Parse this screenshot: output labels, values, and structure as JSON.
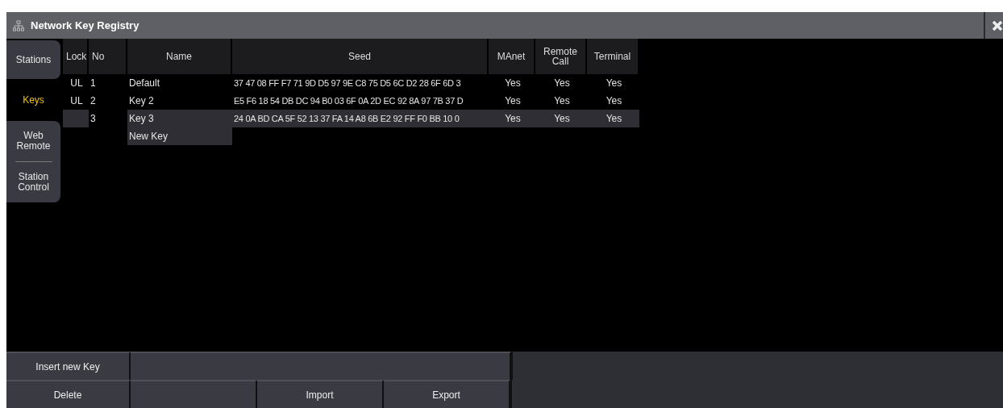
{
  "window": {
    "title": "Network Key Registry"
  },
  "tabs": [
    {
      "label": "Stations",
      "selected": false
    },
    {
      "label": "Keys",
      "selected": true
    },
    {
      "label": "Web Remote",
      "selected": false
    },
    {
      "label": "Station Control",
      "selected": false
    }
  ],
  "table": {
    "columns": [
      "Lock",
      "No",
      "Name",
      "Seed",
      "MAnet",
      "Remote Call",
      "Terminal"
    ],
    "rows": [
      {
        "lock": "UL",
        "no": "1",
        "name": "Default",
        "seed": "37 47 08 FF F7 71 9D D5 97 9E C8 75 D5 6C D2 28 6F 6D 3",
        "manet": "Yes",
        "remote_call": "Yes",
        "terminal": "Yes",
        "selected": false
      },
      {
        "lock": "UL",
        "no": "2",
        "name": "Key 2",
        "seed": "E5 F6 18 54 DB DC 94 B0 03 6F 0A 2D EC 92 8A 97 7B 37 D",
        "manet": "Yes",
        "remote_call": "Yes",
        "terminal": "Yes",
        "selected": false
      },
      {
        "no": "3",
        "name": "Key 3",
        "seed": "24 0A BD CA 5F 52 13 37 FA 14 A8 6B E2 92 FF F0 BB 10 0",
        "manet": "Yes",
        "remote_call": "Yes",
        "terminal": "Yes",
        "selected": true
      }
    ],
    "new_row": "New Key"
  },
  "buttons": [
    {
      "label": "Insert new Key"
    },
    {
      "label": "Delete"
    },
    {
      "label": "Import"
    },
    {
      "label": "Export"
    }
  ]
}
